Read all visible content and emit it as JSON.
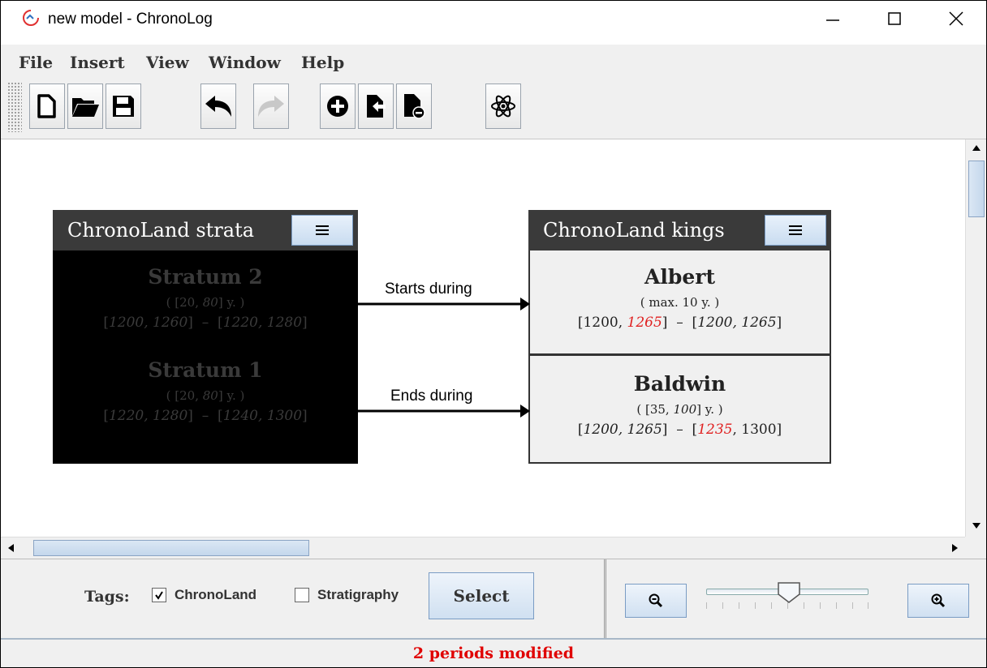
{
  "window": {
    "title": "new model - ChronoLog",
    "controls": [
      "minimize-icon",
      "maximize-icon",
      "close-icon"
    ]
  },
  "menu": [
    "File",
    "Insert",
    "View",
    "Window",
    "Help"
  ],
  "toolbar": {
    "buttons": [
      {
        "icon": "new-file-icon"
      },
      {
        "icon": "open-folder-icon"
      },
      {
        "icon": "save-icon"
      },
      {
        "icon": "undo-icon"
      },
      {
        "icon": "redo-icon",
        "disabled": true
      },
      {
        "icon": "add-circle-icon"
      },
      {
        "icon": "import-icon"
      },
      {
        "icon": "export-icon"
      },
      {
        "icon": "atom-icon"
      }
    ]
  },
  "graph": {
    "strata": {
      "title": "ChronoLand strata",
      "periods": [
        {
          "name": "Stratum 2",
          "duration": {
            "pre": "( [20, ",
            "it": "80",
            "post": "] y. )"
          },
          "span_a": "1200, 1260",
          "span_b": "1220, 1280"
        },
        {
          "name": "Stratum 1",
          "duration": {
            "pre": "( [20, ",
            "it": "80",
            "post": "] y. )"
          },
          "span_a": "1220, 1280",
          "span_b": "1240, 1300"
        }
      ]
    },
    "kings": {
      "title": "ChronoLand kings",
      "periods": [
        {
          "name": "Albert",
          "duration": "( max. 10 y. )"
        },
        {
          "name": "Baldwin",
          "duration": {
            "pre": "( [35, ",
            "it": "100",
            "post": "] y. )"
          }
        }
      ]
    },
    "edges": [
      {
        "label": "Starts during"
      },
      {
        "label": "Ends during"
      }
    ]
  },
  "tags": {
    "label": "Tags:",
    "items": [
      {
        "label": "ChronoLand",
        "checked": true
      },
      {
        "label": "Stratigraphy",
        "checked": false
      }
    ],
    "select_label": "Select"
  },
  "zoom": {
    "level_fraction": 0.45,
    "tick_count": 11
  },
  "status": {
    "text": "2 periods modified",
    "color": "#e00000"
  },
  "colors": {
    "highlight": "#e02020",
    "header": "#3a3a3a"
  }
}
